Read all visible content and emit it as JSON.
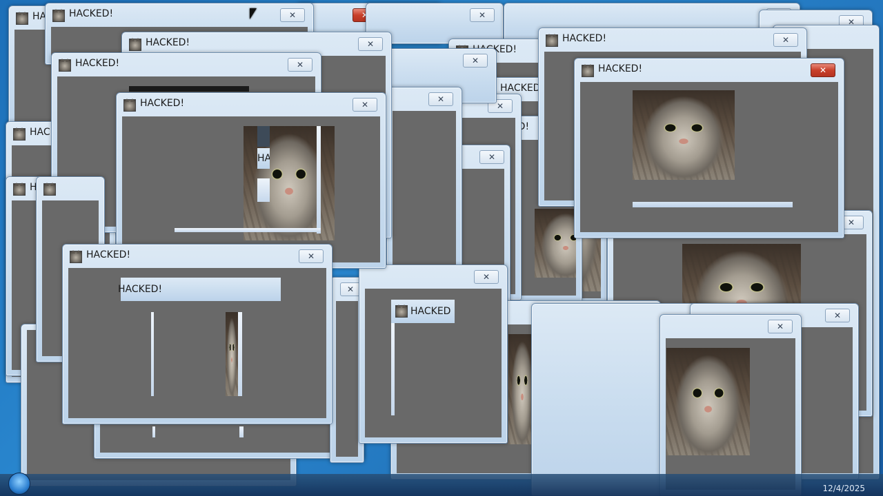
{
  "app": {
    "window_title": "HACKED!",
    "partial_titles": [
      "HACKED",
      "HAC",
      "H",
      "HACKED!"
    ]
  },
  "close_glyph": "✕",
  "taskbar": {
    "clock_date": "12/4/2025"
  },
  "colors": {
    "client_gray": "#696969",
    "title_gradient_top": "#dce9f5",
    "close_red": "#c8402b",
    "desktop_blue": "#1d6fb8"
  },
  "icons": {
    "window_icon": "cat-icon",
    "close": "close-icon",
    "cursor": "mouse-pointer-icon",
    "start": "start-orb-icon"
  }
}
